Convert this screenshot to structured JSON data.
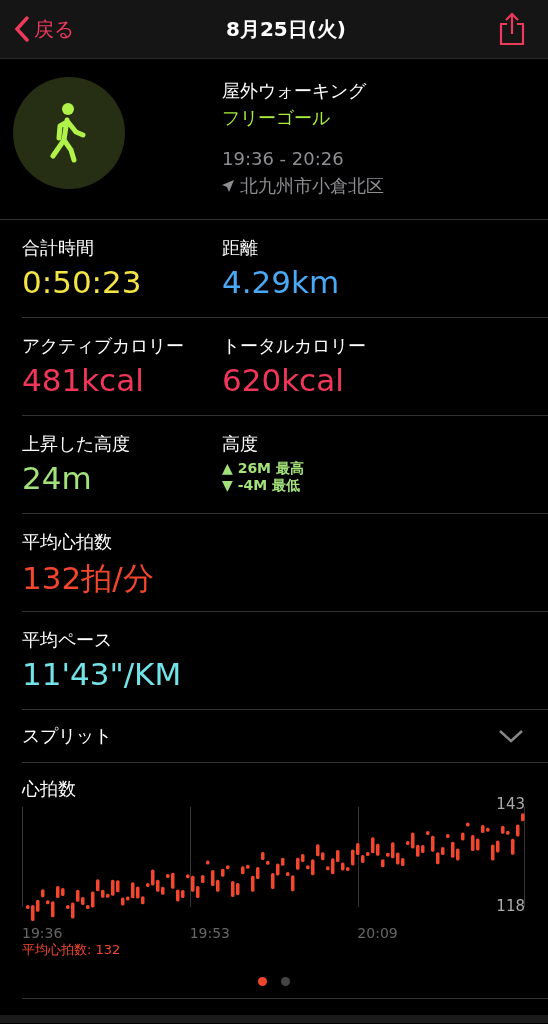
{
  "nav": {
    "back": "戻る",
    "title": "8月25日(火)"
  },
  "workout": {
    "type": "屋外ウォーキング",
    "goal": "フリーゴール",
    "time": "19:36 - 20:26",
    "location": "北九州市小倉北区"
  },
  "metrics": [
    [
      {
        "kind": "value",
        "label": "合計時間",
        "value": "0:50:23",
        "color": "#f4e445"
      },
      {
        "kind": "value",
        "label": "距離",
        "value": "4.29km",
        "color": "#4aa9f4"
      }
    ],
    [
      {
        "kind": "value",
        "label": "アクティブカロリー",
        "value": "481kcal",
        "color": "#f2365a"
      },
      {
        "kind": "value",
        "label": "トータルカロリー",
        "value": "620kcal",
        "color": "#f2365a"
      }
    ],
    [
      {
        "kind": "value",
        "label": "上昇した高度",
        "value": "24m",
        "color": "#a3e27a"
      },
      {
        "kind": "range",
        "label": "高度",
        "high": "▲ 26M 最高",
        "low": "▼ -4M 最低",
        "color": "#a3e27a"
      }
    ],
    [
      {
        "kind": "value",
        "label": "平均心拍数",
        "value": "132拍/分",
        "color": "#f4462c"
      }
    ],
    [
      {
        "kind": "value",
        "label": "平均ペース",
        "value": "11'43\"/KM",
        "color": "#72e3e8"
      }
    ]
  ],
  "splits": {
    "label": "スプリット",
    "expanded": false
  },
  "heart_rate": {
    "title": "心拍数",
    "max": "143",
    "min": "118",
    "times": [
      "19:36",
      "19:53",
      "20:09"
    ],
    "average": "平均心拍数: 132"
  },
  "pages": [
    {
      "selected": true
    },
    {
      "selected": false
    }
  ]
}
